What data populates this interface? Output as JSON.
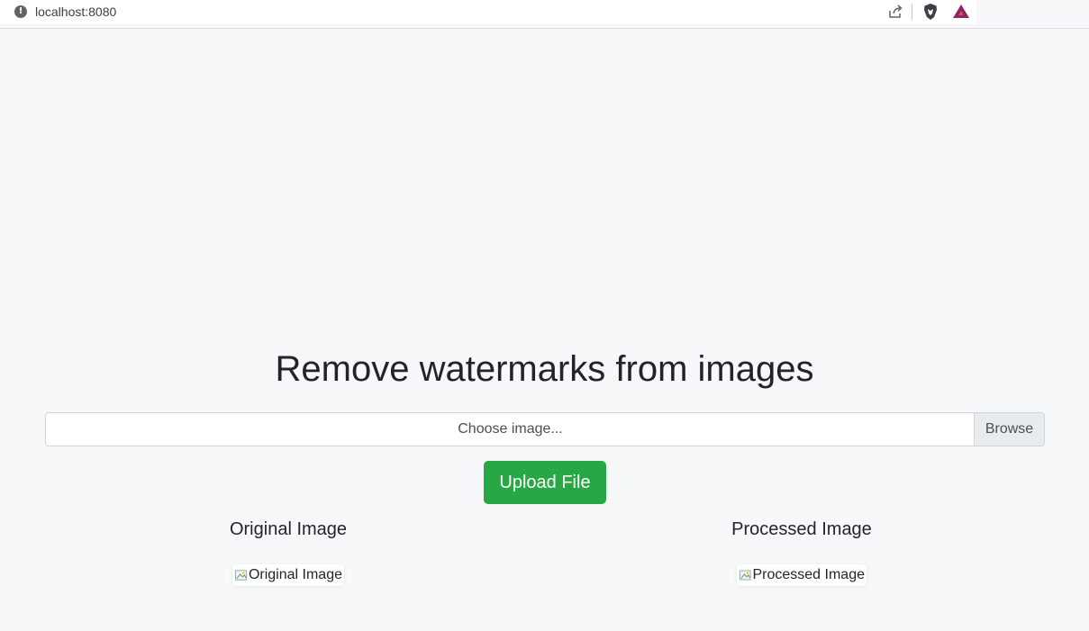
{
  "browser": {
    "url": "localhost:8080",
    "icons": [
      "info-icon",
      "share-icon",
      "brave-shield-icon",
      "bat-rewards-icon"
    ]
  },
  "page": {
    "title": "Remove watermarks from images",
    "file_input": {
      "placeholder": "Choose image...",
      "browse_label": "Browse"
    },
    "upload_button": "Upload File",
    "original": {
      "heading": "Original Image",
      "alt": "Original Image"
    },
    "processed": {
      "heading": "Processed Image",
      "alt": "Processed Image"
    }
  },
  "colors": {
    "background": "#f7f8fa",
    "upload_button": "#28a745",
    "text": "#212529"
  }
}
